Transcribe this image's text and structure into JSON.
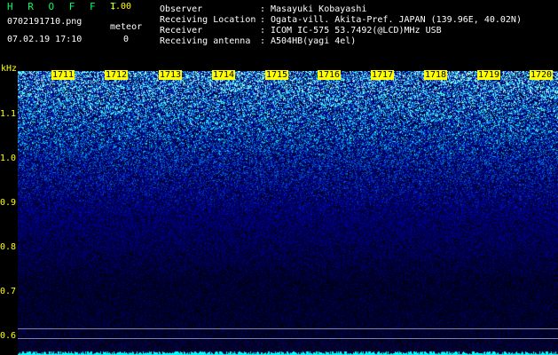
{
  "header": {
    "app_title": "H R O F F T",
    "app_version": "1.00",
    "file_name": "0702191710.png",
    "meteor_label": "meteor",
    "datetime": "07.02.19 17:10",
    "meteor_count": "0"
  },
  "info": [
    {
      "label": "Observer",
      "value": "Masayuki Kobayashi"
    },
    {
      "label": "Receiving Location",
      "value": "Ogata-vill. Akita-Pref. JAPAN (139.96E, 40.02N)"
    },
    {
      "label": "Receiver",
      "value": "ICOM IC-575 53.7492(@LCD)MHz USB"
    },
    {
      "label": "Receiving antenna",
      "value": "A504HB(yagi 4el)"
    }
  ],
  "spectrogram": {
    "freq_unit": "kHz",
    "freq_ticks": [
      "1.1",
      "1.0",
      "0.9",
      "0.8",
      "0.7",
      "0.6"
    ],
    "time_labels": [
      "1711",
      "1712",
      "1713",
      "1714",
      "1715",
      "1716",
      "1717",
      "1718",
      "1719",
      "1720"
    ],
    "colors": {
      "label": "#ffff00",
      "title": "#00ff66",
      "background": "#000014",
      "noise_low": "#0000a0",
      "noise_high": "#00ffcc",
      "baseline": "#00ffff"
    }
  }
}
